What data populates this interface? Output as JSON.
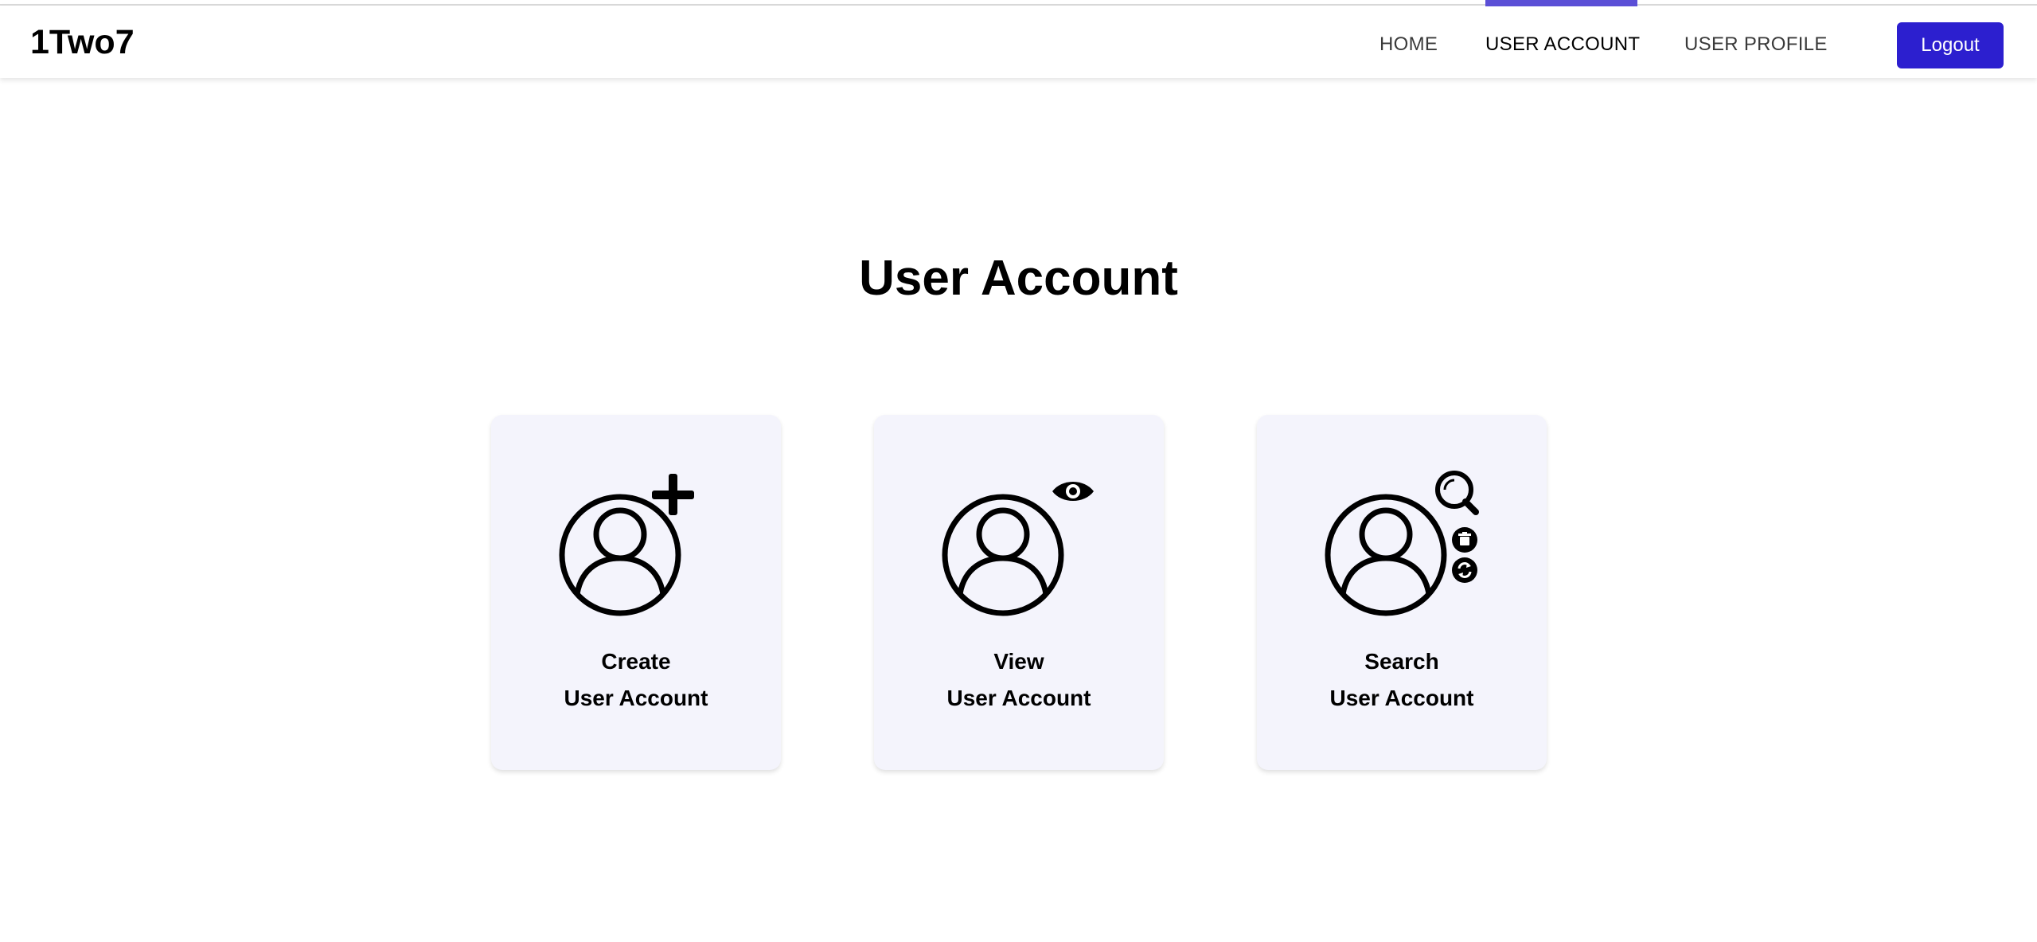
{
  "header": {
    "brand": "1Two7",
    "nav": [
      {
        "label": "HOME"
      },
      {
        "label": "USER ACCOUNT"
      },
      {
        "label": "USER PROFILE"
      }
    ],
    "logout_label": "Logout",
    "accent_color": "#5b4fd6",
    "button_color": "#2c1fcf"
  },
  "main": {
    "title": "User Account",
    "cards": [
      {
        "line1": "Create",
        "line2": "User Account",
        "icon": "user-add-icon"
      },
      {
        "line1": "View",
        "line2": "User Account",
        "icon": "user-view-icon"
      },
      {
        "line1": "Search",
        "line2": "User Account",
        "icon": "user-search-icon"
      }
    ],
    "card_background": "#f4f4fc"
  }
}
